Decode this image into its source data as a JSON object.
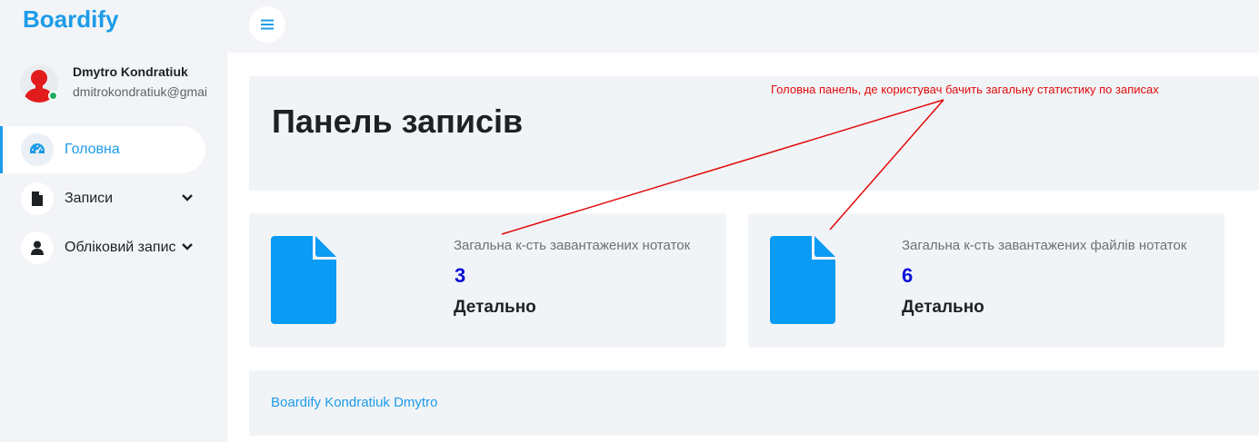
{
  "brand": {
    "name": "Boardify",
    "color": "#1c9be8"
  },
  "user": {
    "name": "Dmytro Kondratiuk",
    "email": "dmitrokondratiuk@gmai",
    "status": "online"
  },
  "sidebar": {
    "items": [
      {
        "label": "Головна",
        "icon": "dashboard-icon",
        "active": true
      },
      {
        "label": "Записи",
        "icon": "document-icon",
        "has_submenu": true
      },
      {
        "label": "Обліковий запис",
        "icon": "user-icon",
        "has_submenu": true
      }
    ]
  },
  "topbar": {
    "menu_icon": "hamburger-icon"
  },
  "main": {
    "title": "Панель записів",
    "cards": [
      {
        "label": "Загальна к-сть завантажених нотаток",
        "count": "3",
        "more_label": "Детально",
        "icon": "file-icon"
      },
      {
        "label": "Загальна к-сть завантажених файлів нотаток",
        "count": "6",
        "more_label": "Детально",
        "icon": "file-icon"
      }
    ],
    "footer": "Boardify Kondratiuk Dmytro"
  },
  "annotation": {
    "text": "Головна панель, де користувач бачить загальну статистику по записах",
    "color": "#e10a0a"
  },
  "colors": {
    "accent": "#1c9be8",
    "count": "#0a10d8",
    "panel_bg": "#f1f4f7"
  }
}
